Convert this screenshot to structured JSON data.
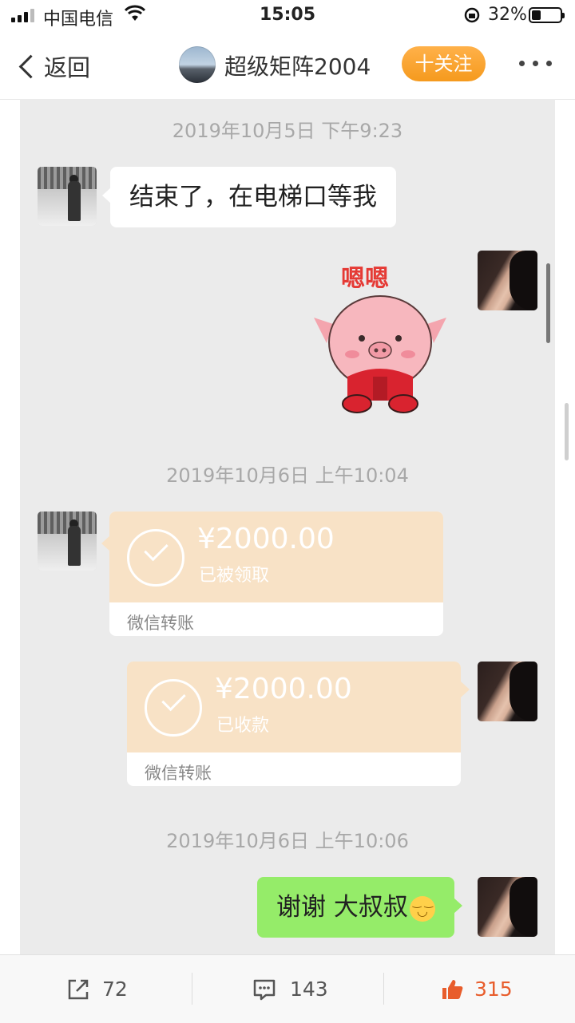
{
  "status_bar": {
    "carrier": "中国电信",
    "time": "15:05",
    "battery_text": "32%",
    "battery_level": 0.32
  },
  "nav": {
    "back_label": "返回",
    "title": "超级矩阵2004",
    "follow_label": "十关注"
  },
  "chat": {
    "timestamps": [
      "2019年10月5日 下午9:23",
      "2019年10月6日 上午10:04",
      "2019年10月6日 上午10:06"
    ],
    "msg1": "结束了，在电梯口等我",
    "sticker_text": "嗯嗯",
    "transfer1": {
      "amount": "¥2000.00",
      "status": "已被领取",
      "footer": "微信转账"
    },
    "transfer2": {
      "amount": "¥2000.00",
      "status": "已收款",
      "footer": "微信转账"
    },
    "msg_last": "谢谢 大叔叔"
  },
  "toolbar": {
    "repost_count": "72",
    "comment_count": "143",
    "like_count": "315"
  },
  "colors": {
    "follow": "#f59a1e",
    "like": "#e85d2c",
    "green_bubble": "#95ec69",
    "transfer": "#f8e2c6"
  }
}
